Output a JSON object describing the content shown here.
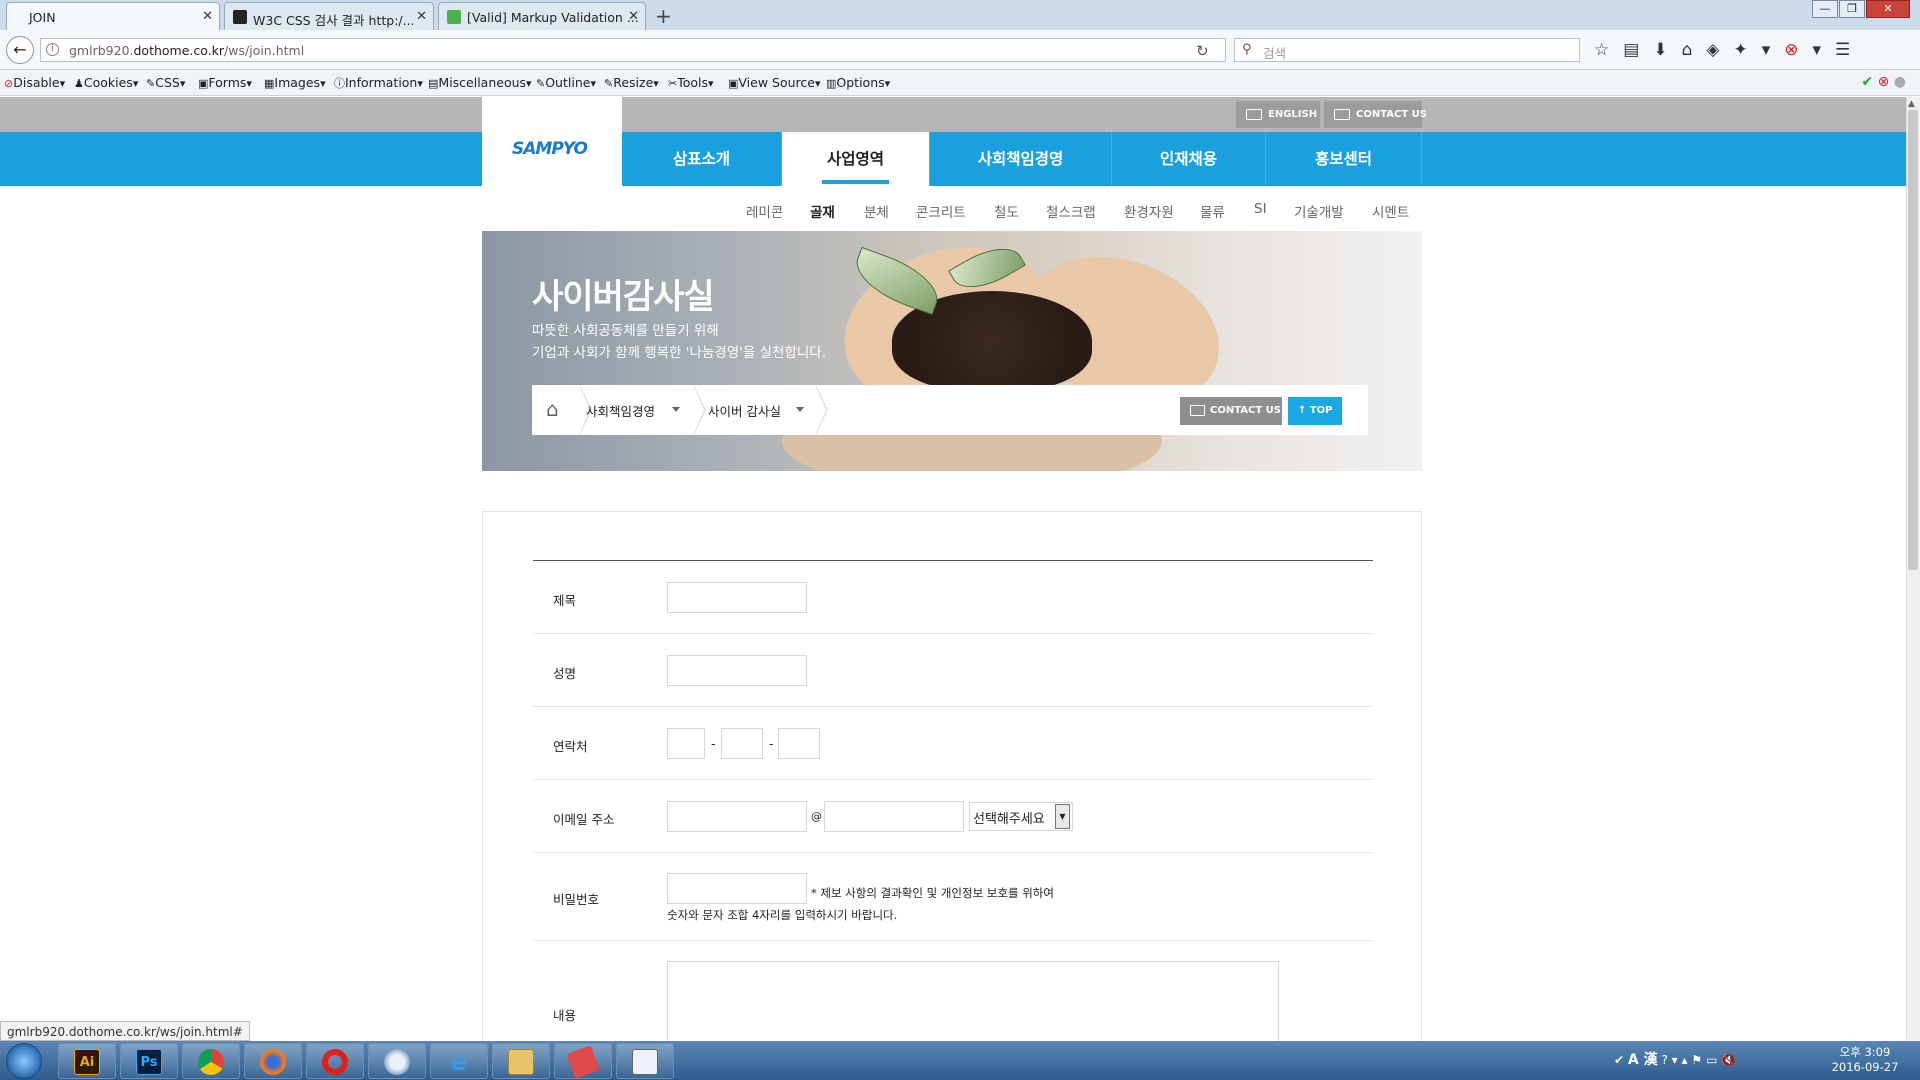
{
  "browser": {
    "tabs": [
      {
        "label": "JOIN",
        "active": true
      },
      {
        "label": "W3C CSS 검사 결과 http:/...",
        "active": false
      },
      {
        "label": "[Valid] Markup Validation ...",
        "active": false
      }
    ],
    "url_prefix": "gmlrb920.",
    "url_domain": "dothome.co.kr",
    "url_path": "/ws/join.html",
    "search_placeholder": "검색",
    "dev_toolbar": [
      "Disable",
      "Cookies",
      "CSS",
      "Forms",
      "Images",
      "Information",
      "Miscellaneous",
      "Outline",
      "Resize",
      "Tools",
      "View Source",
      "Options"
    ],
    "status_url": "gmlrb920.dothome.co.kr/ws/join.html#"
  },
  "site": {
    "top_links": {
      "english": "ENGLISH",
      "contact": "CONTACT US"
    },
    "logo": "SAMPYO",
    "menu": [
      {
        "label": "삼표소개",
        "active": false
      },
      {
        "label": "사업영역",
        "active": true
      },
      {
        "label": "사회책임경영",
        "active": false
      },
      {
        "label": "인재채용",
        "active": false
      },
      {
        "label": "홍보센터",
        "active": false
      }
    ],
    "submenu": [
      {
        "label": "레미콘",
        "active": false
      },
      {
        "label": "골재",
        "active": true
      },
      {
        "label": "분체",
        "active": false
      },
      {
        "label": "콘크리트",
        "active": false
      },
      {
        "label": "철도",
        "active": false
      },
      {
        "label": "철스크랩",
        "active": false
      },
      {
        "label": "환경자원",
        "active": false
      },
      {
        "label": "물류",
        "active": false
      },
      {
        "label": "SI",
        "active": false
      },
      {
        "label": "기술개발",
        "active": false
      },
      {
        "label": "시멘트",
        "active": false
      }
    ],
    "hero": {
      "title": "사이버감사실",
      "line1": "따뜻한 사회공동체를 만들기 위해",
      "line2": "기업과 사회가 함께 행복한 '나눔경영'을 실천합니다."
    },
    "breadcrumb": {
      "level1": "사회책임경영",
      "level2": "사이버 감사실"
    },
    "contact_btn": "CONTACT US",
    "top_btn": "↑ TOP"
  },
  "form": {
    "labels": {
      "title": "제목",
      "name": "성명",
      "phone": "연락처",
      "email": "이메일 주소",
      "password": "비밀번호",
      "content": "내용"
    },
    "email_at": "@",
    "email_domain_select": "선택해주세요",
    "phone_sep": "-",
    "password_note_1": "* 제보 사항의 결과확인 및 개인정보 보호를 위하여",
    "password_note_2": "숫자와 문자 조합 4자리를 입력하시기 바랍니다."
  },
  "taskbar": {
    "apps": [
      "Ai",
      "Ps",
      "Chrome",
      "Firefox",
      "Opera",
      "Safari",
      "IE",
      "Explorer",
      "App",
      "App2"
    ],
    "ime": "A 漢",
    "time": "오후 3:09",
    "date": "2016-09-27"
  }
}
